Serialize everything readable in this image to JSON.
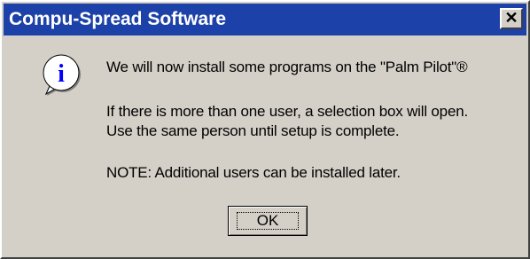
{
  "window": {
    "title": "Compu-Spread Software",
    "close_glyph": "✕"
  },
  "icon": {
    "name": "info-icon",
    "glyph": "i"
  },
  "message": {
    "line1": "We will now install some programs on the \"Palm Pilot\"®",
    "line2": "If there is more than one user, a selection box will open.",
    "line3": "Use the same person until setup is complete.",
    "line4": "NOTE: Additional users can be installed later."
  },
  "buttons": {
    "ok_label": "OK"
  },
  "colors": {
    "titlebar": "#1c41a8",
    "dialog_face": "#d4d0c8",
    "icon_fill": "#0000ff"
  }
}
